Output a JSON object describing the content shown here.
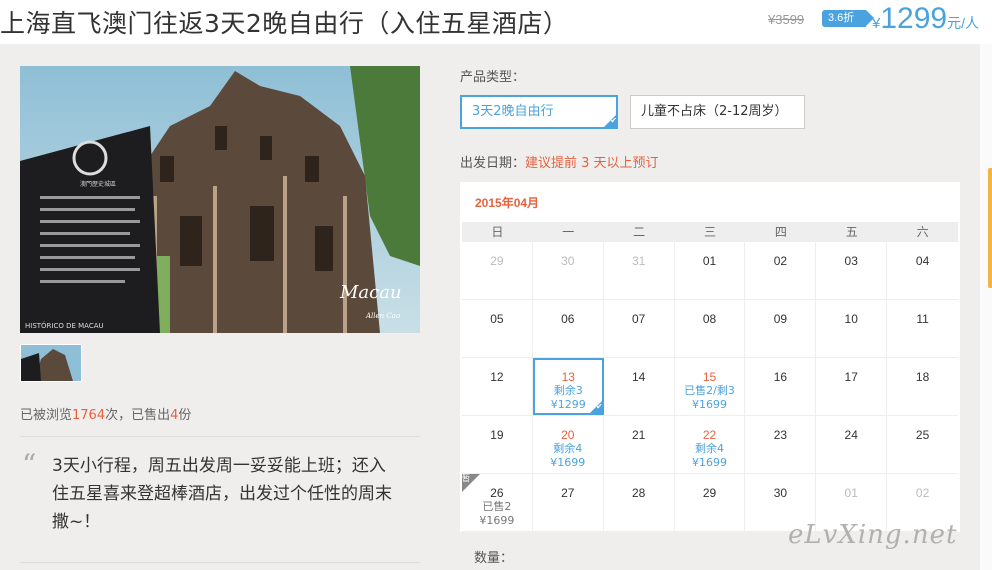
{
  "header": {
    "title": "上海直飞澳门往返3天2晚自由行（入住五星酒店）",
    "price_old": "¥3599",
    "discount": "3.6折",
    "price_symbol": "¥",
    "price_now": "1299",
    "price_unit": "元/人"
  },
  "gallery": {
    "photo_caption": "Macau",
    "photo_signature": "Allen Cao",
    "sign_text": "澳門歷史城區",
    "sign_bottom": "HISTÓRICO DE MACAU"
  },
  "stats": {
    "prefix": "已被浏览",
    "views": "1764",
    "mid": "次，已售出",
    "sold": "4",
    "suffix": "份"
  },
  "quote": {
    "mark": "“",
    "text": "3天小行程，周五出发周一妥妥能上班；还入住五星喜来登超棒酒店，出发过个任性的周末撒~！"
  },
  "booking": {
    "type_label": "产品类型：",
    "types": [
      {
        "label": "3天2晚自由行",
        "selected": true
      },
      {
        "label": "儿童不占床（2-12周岁）",
        "selected": false
      }
    ],
    "date_label": "出发日期：",
    "date_tip": "建议提前 3 天以上预订",
    "month": "2015年04月",
    "weekdays": [
      "日",
      "一",
      "二",
      "三",
      "四",
      "五",
      "六"
    ],
    "weeks": [
      [
        {
          "d": "29",
          "dim": true
        },
        {
          "d": "30",
          "dim": true
        },
        {
          "d": "31",
          "dim": true
        },
        {
          "d": "01"
        },
        {
          "d": "02"
        },
        {
          "d": "03"
        },
        {
          "d": "04"
        }
      ],
      [
        {
          "d": "05"
        },
        {
          "d": "06"
        },
        {
          "d": "07"
        },
        {
          "d": "08"
        },
        {
          "d": "09"
        },
        {
          "d": "10"
        },
        {
          "d": "11"
        }
      ],
      [
        {
          "d": "12"
        },
        {
          "d": "13",
          "red": true,
          "l1": "剩余3",
          "l2": "¥1299",
          "selected": true
        },
        {
          "d": "14"
        },
        {
          "d": "15",
          "red": true,
          "l1": "已售2/剩3",
          "l2": "¥1699"
        },
        {
          "d": "16"
        },
        {
          "d": "17"
        },
        {
          "d": "18"
        }
      ],
      [
        {
          "d": "19"
        },
        {
          "d": "20",
          "red": true,
          "l1": "剩余4",
          "l2": "¥1699"
        },
        {
          "d": "21"
        },
        {
          "d": "22",
          "red": true,
          "l1": "剩余4",
          "l2": "¥1699"
        },
        {
          "d": "23"
        },
        {
          "d": "24"
        },
        {
          "d": "25"
        }
      ],
      [
        {
          "d": "26",
          "l1": "已售2",
          "l2": "¥1699",
          "gray": true,
          "badge": "暂"
        },
        {
          "d": "27"
        },
        {
          "d": "28"
        },
        {
          "d": "29"
        },
        {
          "d": "30"
        },
        {
          "d": "01",
          "dim": true
        },
        {
          "d": "02",
          "dim": true
        }
      ]
    ],
    "qty_label": "数量："
  },
  "watermark": "eLvXing.net",
  "colors": {
    "accent": "#4aa3df",
    "highlight": "#e8613d",
    "page_bg": "#efeeec"
  },
  "icons": {
    "check": "check-icon",
    "quote": "quote-icon"
  }
}
